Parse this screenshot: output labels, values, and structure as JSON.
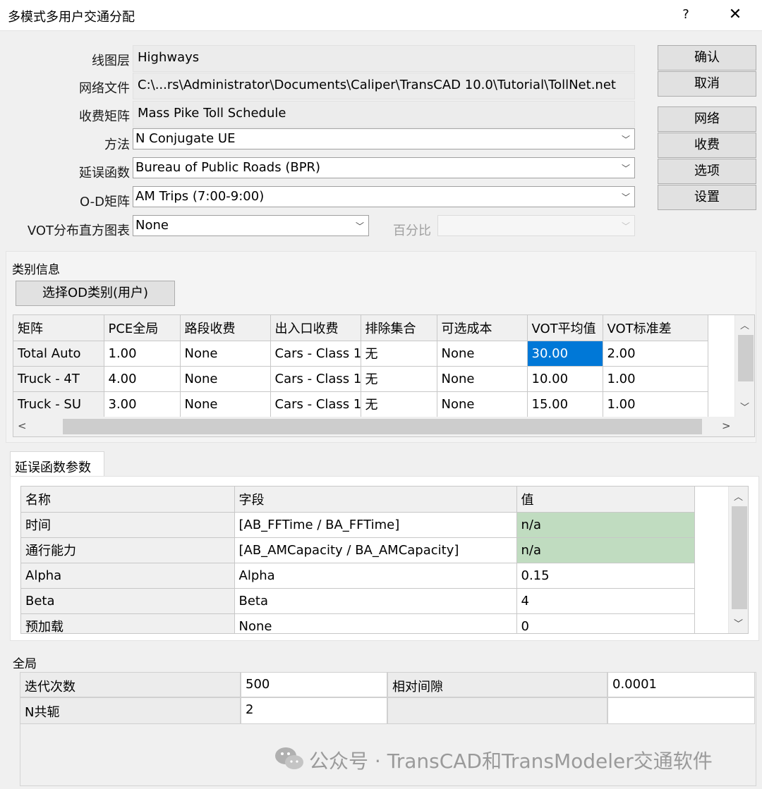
{
  "window": {
    "title": "多模式多用户交通分配",
    "help": "?",
    "close": "✕"
  },
  "form": {
    "line_layer_label": "线图层",
    "line_layer_value": "Highways",
    "network_label": "网络文件",
    "network_value": "C:\\...rs\\Administrator\\Documents\\Caliper\\TransCAD 10.0\\Tutorial\\TollNet.net",
    "toll_matrix_label": "收费矩阵",
    "toll_matrix_value": "Mass Pike Toll Schedule",
    "method_label": "方法",
    "method_value": "N Conjugate UE",
    "delay_label": "延误函数",
    "delay_value": "Bureau of Public Roads (BPR)",
    "od_label": "O-D矩阵",
    "od_value": "AM Trips (7:00-9:00)",
    "vot_label": "VOT分布直方图表",
    "vot_value": "None",
    "percent_label": "百分比",
    "percent_value": ""
  },
  "buttons": {
    "ok": "确认",
    "cancel": "取消",
    "network": "网络",
    "toll": "收费",
    "options": "选项",
    "settings": "设置"
  },
  "class_info": {
    "section": "类别信息",
    "select_button": "选择OD类别(用户)",
    "columns": [
      "矩阵",
      "PCE全局",
      "路段收费",
      "出入口收费",
      "排除集合",
      "可选成本",
      "VOT平均值",
      "VOT标准差"
    ],
    "rows": [
      [
        "Total Auto",
        "1.00",
        "None",
        "Cars - Class 1",
        "无",
        "None",
        "30.00",
        "2.00"
      ],
      [
        "Truck - 4T",
        "4.00",
        "None",
        "Cars - Class 1",
        "无",
        "None",
        "10.00",
        "1.00"
      ],
      [
        "Truck - SU",
        "3.00",
        "None",
        "Cars - Class 1",
        "无",
        "None",
        "15.00",
        "1.00"
      ]
    ]
  },
  "delay_params": {
    "tab": "延误函数参数",
    "columns": [
      "名称",
      "字段",
      "值"
    ],
    "rows": [
      [
        "时间",
        "[AB_FFTime / BA_FFTime]",
        "n/a"
      ],
      [
        "通行能力",
        "[AB_AMCapacity / BA_AMCapacity]",
        "n/a"
      ],
      [
        "Alpha",
        "Alpha",
        "0.15"
      ],
      [
        "Beta",
        "Beta",
        "4"
      ],
      [
        "预加载",
        "None",
        "0"
      ]
    ]
  },
  "global": {
    "section": "全局",
    "iter_label": "迭代次数",
    "iter_value": "500",
    "gap_label": "相对间隙",
    "gap_value": "0.0001",
    "nconj_label": "N共轭",
    "nconj_value": "2"
  },
  "watermark": "公众号 · TransCAD和TransModeler交通软件",
  "colors": {
    "selection": "#0078d7",
    "na_cell": "#c0dcc0"
  }
}
